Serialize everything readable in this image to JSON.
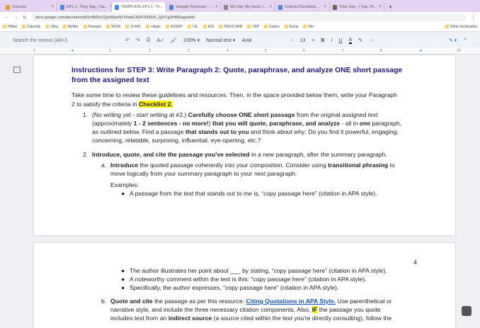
{
  "browser": {
    "tabs": [
      "Courses",
      "EP1 1: They Say, I Sa...",
      "TEMPLATE EP1 1: Th...",
      "Sample Summary - ...",
      "My City, My hood: t...",
      "Criteria Checklists ...",
      "They Say - I Say: Pr..."
    ],
    "active_tab": 2,
    "url": "docs.google.com/document/d/1nfWDxUQyhMpxN1YhwtlC4ZrF5392/K_Q/X7g3hWKlug/edit#",
    "bookmarks": [
      "HMail",
      "Calendly",
      "Ultra",
      "MyNbr",
      "Panopto",
      "W100",
      "O+MS",
      "+Apps",
      "ASSMT",
      "CIL",
      "EDI",
      "PED/CURR",
      "TEP",
      "Subori",
      "Emoji",
      "Hbr"
    ],
    "other_bookmarks": "Other bookmarks"
  },
  "toolbar": {
    "search_placeholder": "Search the menus (Alt+/)",
    "zoom": "100%",
    "style": "Normal text",
    "font": "Arial",
    "size": "13",
    "bold": "B",
    "italic": "I",
    "underline": "U",
    "text_color": "A"
  },
  "ruler": [
    "1",
    "1",
    "2",
    "3",
    "4",
    "5",
    "6",
    "7",
    "8",
    "10"
  ],
  "doc": {
    "heading1": "Instructions for STEP 3: Write Paragraph 2: Quote, paraphrase, and analyze ONE short passage",
    "heading2": "from the assigned text",
    "intro1": "Take some time to review these guidelines and resources. Then, in the space provided below them, write your Paragraph",
    "intro2a": "2 to satisfy the criteria in ",
    "intro2b": "Checklist 2.",
    "i1n": "1.",
    "i1a": "(No writing yet - start writing at #2.) ",
    "i1b": "Carefully choose ONE short passage",
    "i1c": " from the original assigned text",
    "i2a": "(approximately ",
    "i2b": "1 - 2 sentences - no more!",
    "i2c": ") ",
    "i2d": "that you will quote, paraphrase, and analyze",
    "i2e": " - all in ",
    "i2f": "one",
    "i2g": " paragraph,",
    "i3a": "as outlined below. Find a passage ",
    "i3b": "that stands out to you",
    "i3c": " and think about why: Do you find it powerful, engaging,",
    "i4": "concerning, relatable, surprising, influential, eye-opening, etc.?",
    "j1n": "2.",
    "j1a": "Introduce, quote, and cite the passage you've selected",
    "j1b": " in a new paragraph, after the summary paragraph.",
    "an": "a.",
    "a1a": "Introduce",
    "a1b": " the quoted passage coherently into your composition. Consider using ",
    "a1c": "transitional phrasing",
    "a1d": " to",
    "a2": "move logically from your summary paragraph to your next paragraph:",
    "examples": "Examples:",
    "b1": "A passage from the text that stands out to me is, “copy passage here” (citation in APA style).",
    "page_num": "4",
    "b2": "The author illustrates her point about ___ by stating, “copy passage here” (citation in APA style).",
    "b3": "A noteworthy comment within the text is this: “copy passage here” (citation in APA style).",
    "b4": "Specifically, the author expresses, “copy passage here” (citation in APA style).",
    "bn": "b.",
    "c1a": "Quote and cite",
    "c1b": " the passage as per this resource: ",
    "c1link": "Citing Quotations in APA Style.",
    "c1c": " Use parenthetical or",
    "c2a": "narrative style, and include the three necessary citation components. Also, ",
    "c2b": "IF",
    "c2c": " the passage you quote",
    "c3a": "includes text from an ",
    "c3b": "indirect source",
    "c3c": " (a source cited within the text you're directly consulting), follow the"
  }
}
